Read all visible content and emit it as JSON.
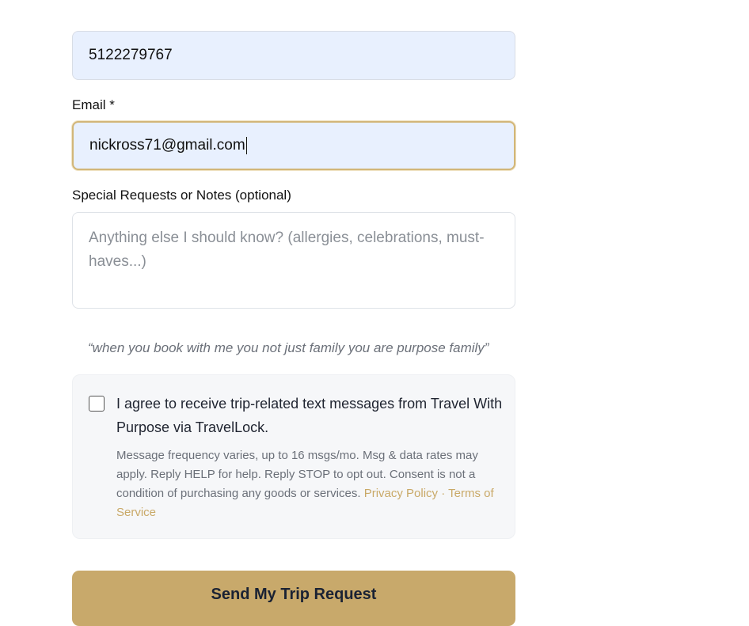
{
  "phone_field": {
    "value": "5122279767"
  },
  "email_field": {
    "label": "Email *",
    "value": "nickross71@gmail.com"
  },
  "notes_field": {
    "label": "Special Requests or Notes (optional)",
    "placeholder": "Anything else I should know? (allergies, celebrations, must-haves...)"
  },
  "quote": "“when you book with me you not just family you are purpose family”",
  "consent": {
    "checkbox_checked": false,
    "text": "I agree to receive trip-related text messages from Travel With Purpose via TravelLock.",
    "fine_print": "Message frequency varies, up to 16 msgs/mo. Msg & data rates may apply. Reply HELP for help. Reply STOP to opt out. Consent is not a condition of purchasing any goods or services.",
    "privacy_link": "Privacy Policy",
    "separator": "·",
    "terms_link": "Terms of Service"
  },
  "submit_button": {
    "label": "Send My Trip Request"
  },
  "colors": {
    "accent_gold": "#c8a96b",
    "link_gold": "#c9a968",
    "autofill_blue": "#e8f0fe"
  }
}
